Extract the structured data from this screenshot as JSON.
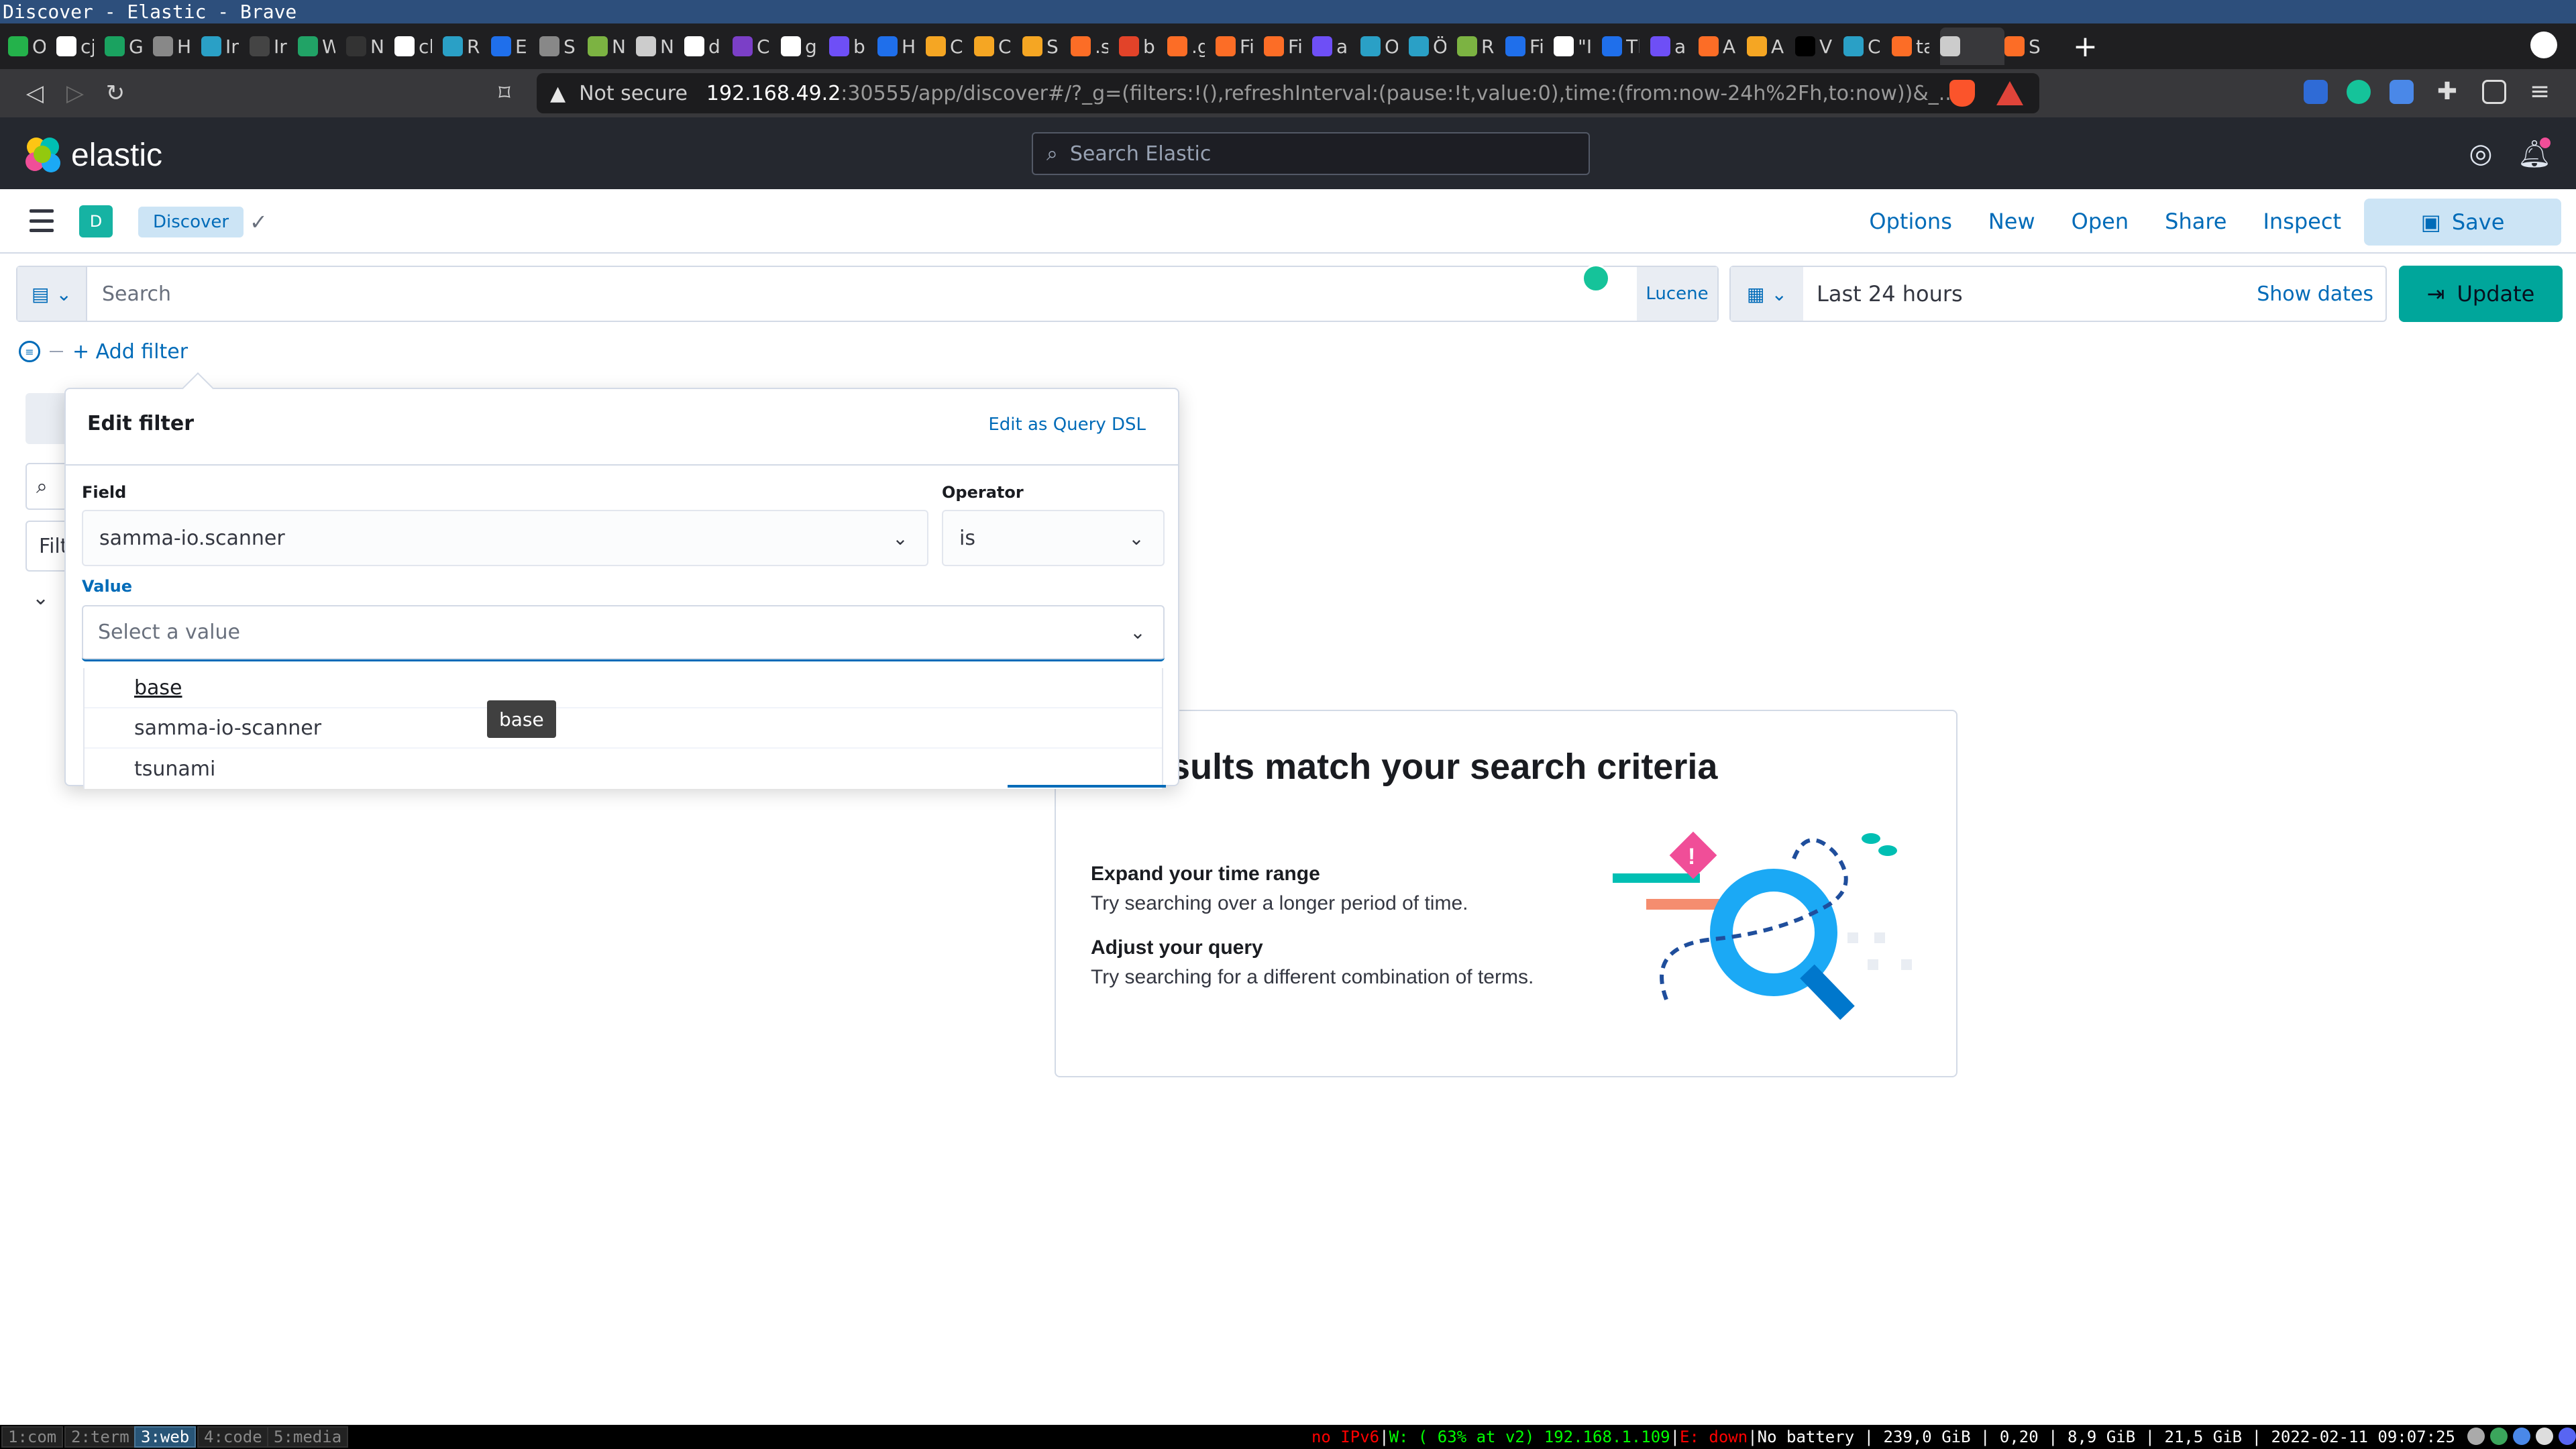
{
  "window_title": "Discover - Elastic - Brave",
  "browser": {
    "tabs": [
      {
        "label": "O",
        "color": "#24b24b"
      },
      {
        "label": "cj",
        "color": "#ffffff"
      },
      {
        "label": "G",
        "color": "#1aa260"
      },
      {
        "label": "H",
        "color": "#888888"
      },
      {
        "label": "In",
        "color": "#2aa0c6"
      },
      {
        "label": "Ir",
        "color": "#444444"
      },
      {
        "label": "W",
        "color": "#21a366"
      },
      {
        "label": "N",
        "color": "#333333"
      },
      {
        "label": "cl",
        "color": "#ffffff"
      },
      {
        "label": "R",
        "color": "#2aa0c6"
      },
      {
        "label": "E",
        "color": "#1f6feb"
      },
      {
        "label": "S",
        "color": "#888888"
      },
      {
        "label": "N",
        "color": "#7cb342"
      },
      {
        "label": "N",
        "color": "#cccccc"
      },
      {
        "label": "d",
        "color": "#ffffff"
      },
      {
        "label": "C",
        "color": "#7b3fc7"
      },
      {
        "label": "g",
        "color": "#ffffff"
      },
      {
        "label": "b",
        "color": "#6e4ff6"
      },
      {
        "label": "H",
        "color": "#1f6feb"
      },
      {
        "label": "C",
        "color": "#f5a623"
      },
      {
        "label": "C",
        "color": "#f5a623"
      },
      {
        "label": "S",
        "color": "#f5a623"
      },
      {
        "label": ".s",
        "color": "#fc6d26"
      },
      {
        "label": "b",
        "color": "#e24329"
      },
      {
        "label": ".g",
        "color": "#fc6d26"
      },
      {
        "label": "Fi",
        "color": "#fc6d26"
      },
      {
        "label": "Fi",
        "color": "#fc6d26"
      },
      {
        "label": "a",
        "color": "#6e4ff6"
      },
      {
        "label": "O",
        "color": "#2aa0c6"
      },
      {
        "label": "Ö",
        "color": "#2aa0c6"
      },
      {
        "label": "R",
        "color": "#7cb342"
      },
      {
        "label": "Fi",
        "color": "#1f6feb"
      },
      {
        "label": "\"I",
        "color": "#ffffff"
      },
      {
        "label": "Tl",
        "color": "#1f6feb"
      },
      {
        "label": "a",
        "color": "#6e4ff6"
      },
      {
        "label": "A",
        "color": "#fc6d26"
      },
      {
        "label": "A",
        "color": "#f5a623"
      },
      {
        "label": "V",
        "color": "#000000"
      },
      {
        "label": "C",
        "color": "#2aa0c6"
      },
      {
        "label": "ta",
        "color": "#fc6d26"
      },
      {
        "label": "",
        "color": "#cccccc"
      },
      {
        "label": "S",
        "color": "#fc6d26"
      }
    ],
    "url_warning": "Not secure",
    "url_host": "192.168.49.2",
    "url_rest": ":30555/app/discover#/?_g=(filters:!(),refreshInterval:(pause:!t,value:0),time:(from:now-24h%2Fh,to:now))&_..."
  },
  "kibana": {
    "brand": "elastic",
    "search_placeholder": "Search Elastic",
    "space_initial": "D",
    "breadcrumb": "Discover",
    "nav": [
      "Options",
      "New",
      "Open",
      "Share",
      "Inspect"
    ],
    "save_label": "Save",
    "query_placeholder": "Search",
    "language_label": "Lucene",
    "date_label": "Last 24 hours",
    "show_dates_label": "Show dates",
    "update_label": "Update",
    "add_filter_label": "+ Add filter",
    "sidebar_filter_fragment": "Filt"
  },
  "edit_filter": {
    "title": "Edit filter",
    "dsl_link": "Edit as Query DSL",
    "field_label": "Field",
    "field_value": "samma-io.scanner",
    "operator_label": "Operator",
    "operator_value": "is",
    "value_label": "Value",
    "value_placeholder": "Select a value",
    "options": [
      "base",
      "samma-io-scanner",
      "tsunami"
    ],
    "tooltip": "base"
  },
  "empty_state": {
    "title": "esults match your search criteria",
    "expand_heading": "Expand your time range",
    "expand_text": "Try searching over a longer period of time.",
    "adjust_heading": "Adjust your query",
    "adjust_text": "Try searching for a different combination of terms."
  },
  "i3": {
    "workspaces": [
      "1:com",
      "2:term",
      "3:web",
      "4:code",
      "5:media"
    ],
    "active_workspace": "3:web",
    "status_red_1": "no IPv6",
    "status_wifi": "W: ( 63% at v2) 192.168.1.109",
    "status_red_2": "E: down",
    "status_rest": "No battery | 239,0 GiB | 0,20 | 8,9 GiB | 21,5 GiB | 2022-02-11 09:07:25"
  }
}
